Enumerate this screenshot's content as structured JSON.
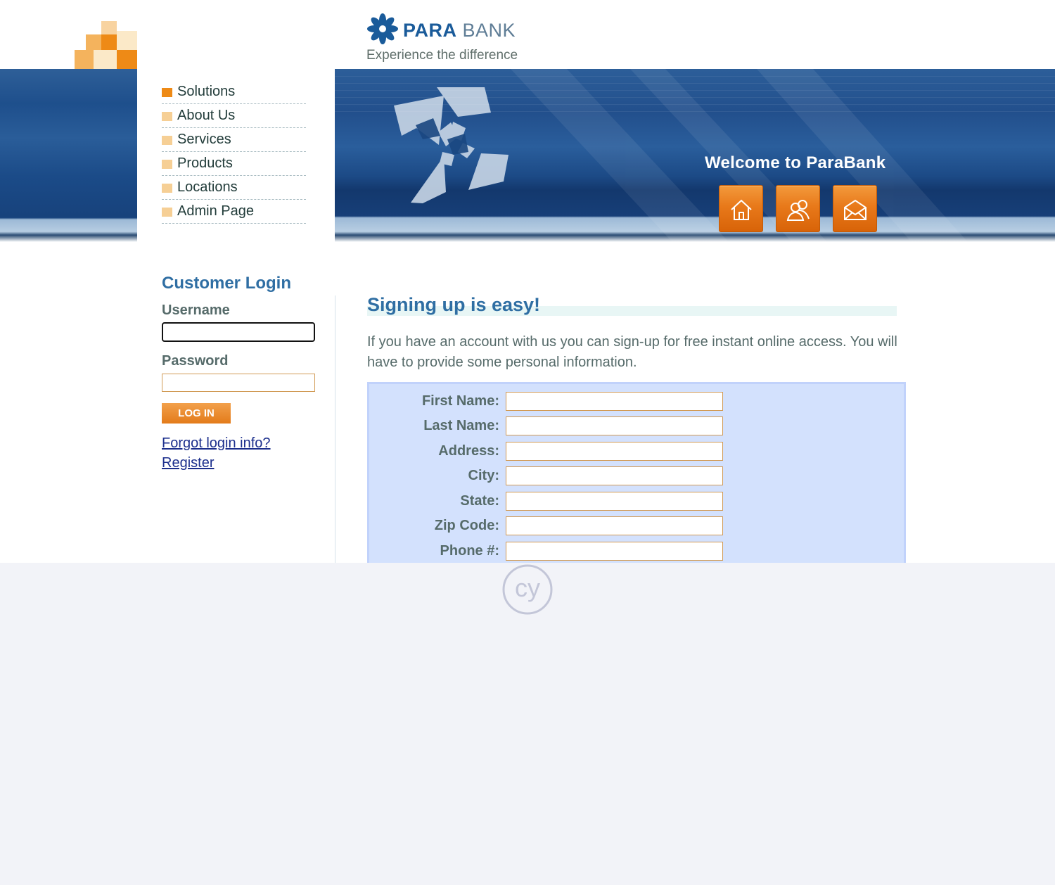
{
  "brand": {
    "name_part1": "PARA",
    "name_part2": "BANK",
    "tagline": "Experience the difference"
  },
  "banner": {
    "welcome": "Welcome to ParaBank",
    "icons": [
      "home-icon",
      "contacts-icon",
      "email-icon"
    ]
  },
  "nav": {
    "items": [
      {
        "label": "Solutions",
        "active": true
      },
      {
        "label": "About Us",
        "active": false
      },
      {
        "label": "Services",
        "active": false
      },
      {
        "label": "Products",
        "active": false
      },
      {
        "label": "Locations",
        "active": false
      },
      {
        "label": "Admin Page",
        "active": false
      }
    ]
  },
  "login": {
    "title": "Customer Login",
    "username_label": "Username",
    "username_value": "",
    "password_label": "Password",
    "password_value": "",
    "button_label": "LOG IN",
    "forgot_link": "Forgot login info?",
    "register_link": "Register"
  },
  "signup": {
    "heading": "Signing up is easy!",
    "intro": "If you have an account with us you can sign-up for free instant online access. You will have to provide some personal information.",
    "fields": [
      {
        "label": "First Name:",
        "value": ""
      },
      {
        "label": "Last Name:",
        "value": ""
      },
      {
        "label": "Address:",
        "value": ""
      },
      {
        "label": "City:",
        "value": ""
      },
      {
        "label": "State:",
        "value": ""
      },
      {
        "label": "Zip Code:",
        "value": ""
      },
      {
        "label": "Phone #:",
        "value": ""
      }
    ]
  },
  "colors": {
    "accent_orange": "#e8791a",
    "heading_blue": "#2f6ea3",
    "form_bg": "#d3e1fd",
    "runner_bg": "#f2f3f8"
  },
  "runner": {
    "logo_text": "cy"
  }
}
